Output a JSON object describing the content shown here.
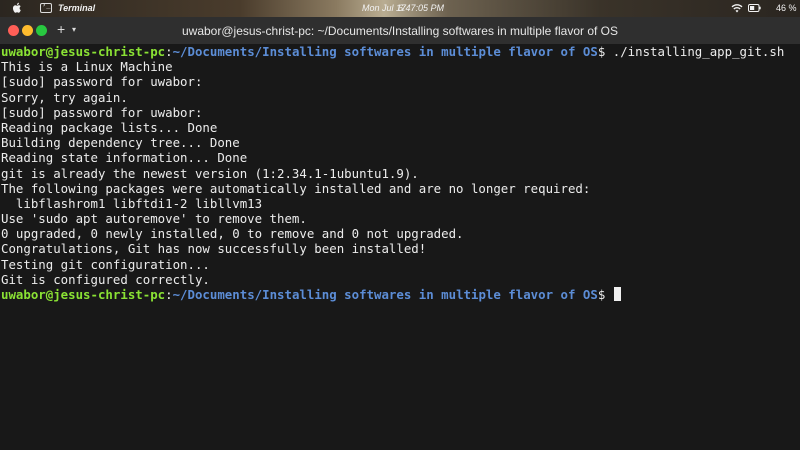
{
  "menubar": {
    "app_name": "Terminal",
    "date": "Mon Jul 17",
    "time": "6:47:05 PM",
    "battery_percent": "46 %",
    "icons": [
      "apple-icon",
      "terminal-icon",
      "wifi-icon",
      "battery-icon"
    ]
  },
  "window": {
    "title": "uwabor@jesus-christ-pc: ~/Documents/Installing softwares in multiple flavor of OS",
    "new_tab_label": "+",
    "tab_menu_label": "▾"
  },
  "terminal": {
    "prompt": {
      "user_host": "uwabor@jesus-christ-pc",
      "colon": ":",
      "path": "~/Documents/Installing softwares in multiple flavor of OS",
      "symbol": "$"
    },
    "command": " ./installing_app_git.sh",
    "output_lines": [
      "This is a Linux Machine",
      "[sudo] password for uwabor:",
      "Sorry, try again.",
      "[sudo] password for uwabor:",
      "Reading package lists... Done",
      "Building dependency tree... Done",
      "Reading state information... Done",
      "git is already the newest version (1:2.34.1-1ubuntu1.9).",
      "The following packages were automatically installed and are no longer required:",
      "  libflashrom1 libftdi1-2 libllvm13",
      "Use 'sudo apt autoremove' to remove them.",
      "0 upgraded, 0 newly installed, 0 to remove and 0 not upgraded.",
      "Congratulations, Git has now successfully been installed!",
      "Testing git configuration...",
      "Git is configured correctly."
    ]
  }
}
